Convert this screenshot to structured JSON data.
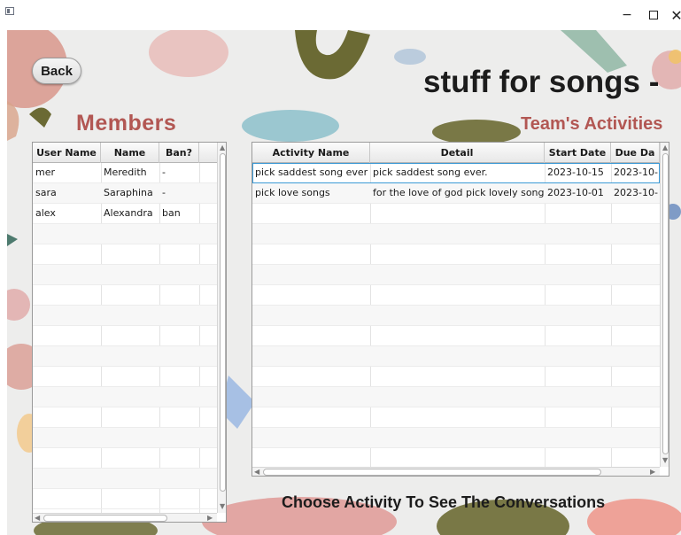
{
  "window": {
    "min_glyph": "−",
    "close_glyph": "✕"
  },
  "nav": {
    "back_label": "Back"
  },
  "team": {
    "name": "stuff for songs -"
  },
  "members": {
    "title": "Members",
    "columns": [
      "User Name",
      "Name",
      "Ban?"
    ],
    "rows": [
      [
        "mer",
        "Meredith",
        "-"
      ],
      [
        "sara",
        "Saraphina",
        "-"
      ],
      [
        "alex",
        "Alexandra",
        "ban"
      ]
    ]
  },
  "activities": {
    "title": "Team's Activities",
    "columns": [
      "Activity Name",
      "Detail",
      "Start Date",
      "Due Da"
    ],
    "rows": [
      [
        "pick saddest song ever",
        "pick saddest song ever.",
        "2023-10-15",
        "2023-10-"
      ],
      [
        "pick love songs",
        "for the love of god pick lovely song",
        "2023-10-01",
        "2023-10-"
      ]
    ]
  },
  "footer": {
    "hint": "Choose Activity To See The Conversations"
  },
  "colors": {
    "section_title": "#b25753",
    "selection_outline": "#3c9ad6"
  }
}
